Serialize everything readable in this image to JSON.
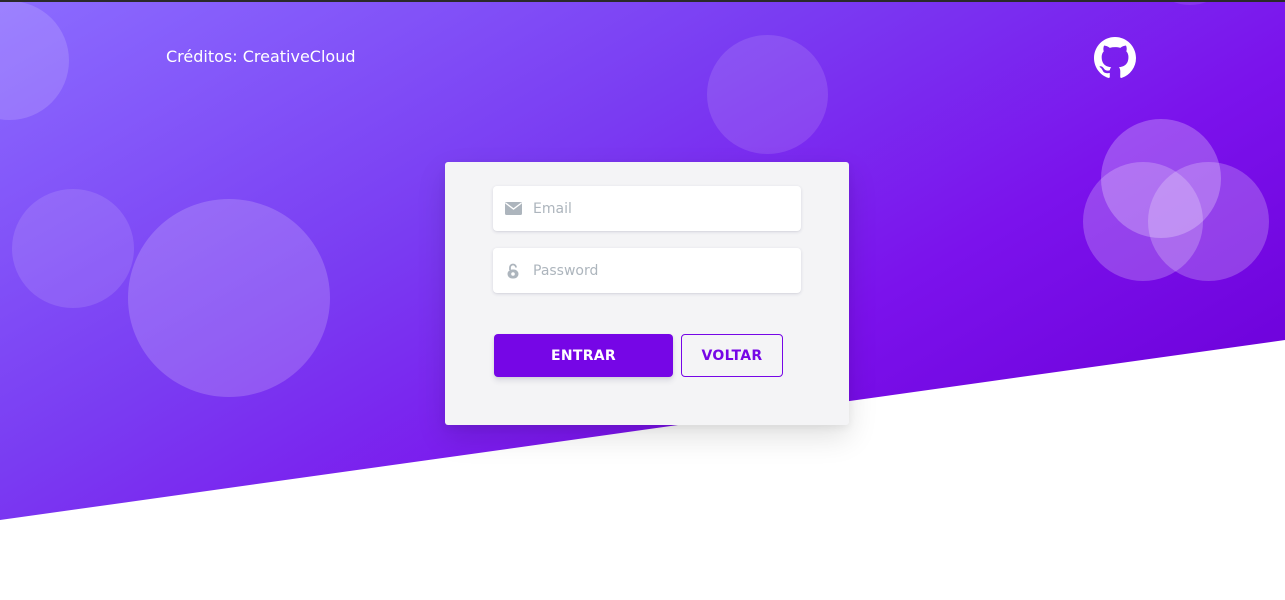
{
  "header": {
    "credits_text": "Créditos: CreativeCloud",
    "github_icon": "github-icon"
  },
  "login_form": {
    "email": {
      "placeholder": "Email",
      "value": "",
      "icon": "envelope-icon"
    },
    "password": {
      "placeholder": "Password",
      "value": "",
      "icon": "lock-icon"
    },
    "submit_label": "ENTRAR",
    "back_label": "VOLTAR"
  },
  "colors": {
    "accent": "#7606e6",
    "hero_start": "#8b6cff",
    "hero_end": "#6200c8",
    "card_bg": "#f4f4f6",
    "icon_gray": "#adb5bd"
  }
}
